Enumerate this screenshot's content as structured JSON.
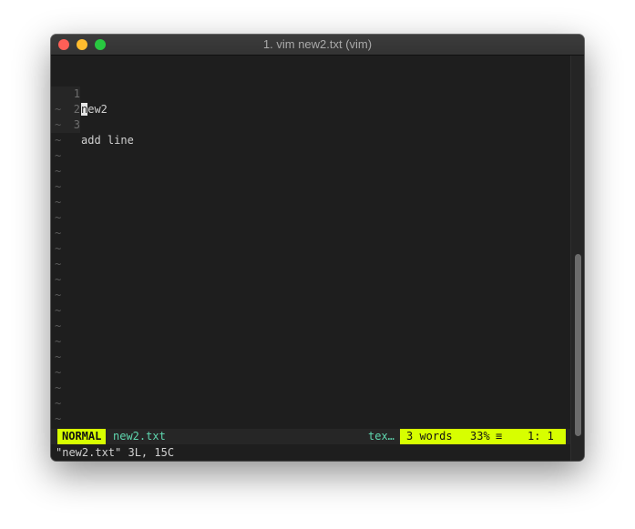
{
  "window": {
    "title": "1. vim new2.txt (vim)",
    "traffic_lights": {
      "close_color": "#fe5f57",
      "minimize_color": "#febc2e",
      "zoom_color": "#28c840"
    }
  },
  "editor": {
    "lines": [
      {
        "number": "1",
        "cursor_char": "n",
        "rest": "ew2"
      },
      {
        "number": "2",
        "cursor_char": "",
        "rest": ""
      },
      {
        "number": "3",
        "cursor_char": "",
        "rest": "add line"
      }
    ],
    "tilde_char": "~",
    "tilde_count": 21
  },
  "statusline": {
    "mode": "NORMAL",
    "filename": "new2.txt",
    "filetype": "tex…",
    "word_count": "3 words",
    "percent": "33%",
    "lines_icon": "≡",
    "position": "1:  1",
    "accent_color": "#d7ff00",
    "filename_color": "#5fd7af"
  },
  "cmdline": {
    "message": "\"new2.txt\" 3L, 15C"
  }
}
